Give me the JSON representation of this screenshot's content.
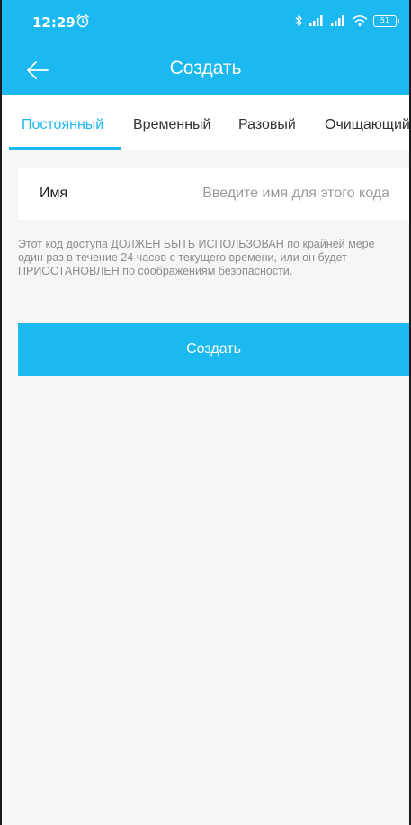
{
  "status_bar": {
    "time": "12:29",
    "battery": "51",
    "icons": [
      "alarm-icon",
      "bluetooth-icon",
      "signal-icon",
      "signal-icon",
      "wifi-icon",
      "battery-icon"
    ]
  },
  "app_bar": {
    "title": "Создать",
    "back_icon": "arrow-left-icon"
  },
  "tabs": [
    {
      "label": "Постоянный",
      "active": true
    },
    {
      "label": "Временный",
      "active": false
    },
    {
      "label": "Разовый",
      "active": false
    },
    {
      "label": "Очищающий",
      "active": false
    }
  ],
  "form": {
    "name_label": "Имя",
    "name_value": "",
    "name_placeholder": "Введите имя для этого кода"
  },
  "hint": "Этот код доступа ДОЛЖЕН БЫТЬ ИСПОЛЬЗОВАН по крайней мере один раз в течение 24 часов с текущего времени, или он будет ПРИОСТАНОВЛЕН по соображениям безопасности.",
  "submit_label": "Создать",
  "colors": {
    "accent": "#1cb8f0",
    "background": "#f6f6f6",
    "surface": "#ffffff",
    "hint_text": "#8c8c8c"
  }
}
